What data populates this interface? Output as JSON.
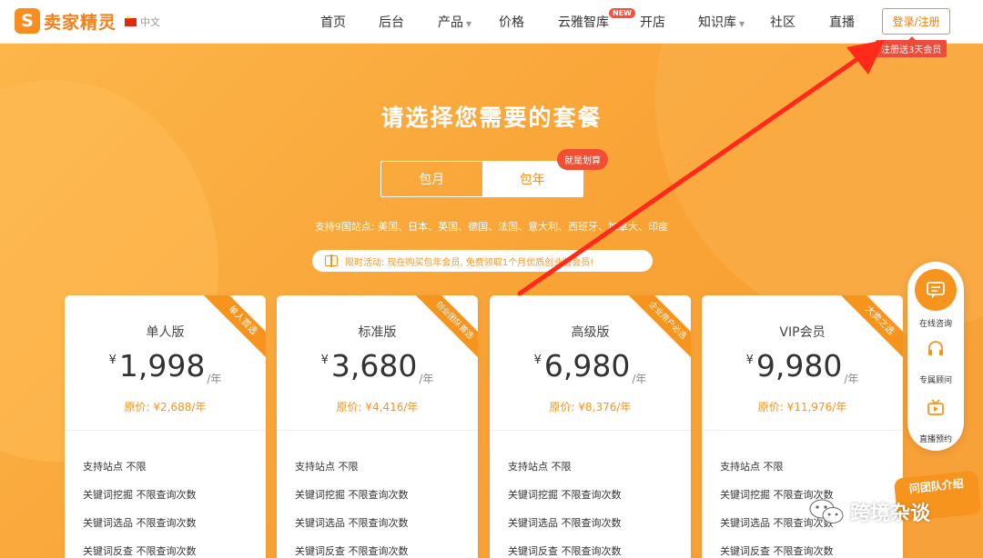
{
  "header": {
    "logo_mark": "S",
    "logo_text": "卖家精灵",
    "language": "中文",
    "nav": [
      {
        "label": "首页"
      },
      {
        "label": "后台"
      },
      {
        "label": "产品"
      },
      {
        "label": "价格"
      },
      {
        "label": "云雅智库"
      },
      {
        "label": "开店"
      },
      {
        "label": "知识库"
      },
      {
        "label": "社区"
      },
      {
        "label": "直播"
      }
    ],
    "new_badge": "NEW",
    "login_label": "登录/注册",
    "register_tip": "注册送3天会员"
  },
  "hero": {
    "title": "请选择您需要的套餐",
    "toggle": {
      "monthly": "包月",
      "yearly": "包年",
      "badge": "就是划算"
    },
    "sites": "支持9国站点: 美国、日本、英国、德国、法国、意大利、西班牙、加拿大、印度",
    "promo": "限时活动: 现在购买包年会员, 免费领取1个月优质创业版会员!"
  },
  "plans": [
    {
      "name": "单人版",
      "ribbon": "单人首选",
      "currency": "¥",
      "price": "1,998",
      "unit": "/年",
      "original": "原价: ¥2,688/年",
      "features": [
        "支持站点 不限",
        "关键词挖掘 不限查询次数",
        "关键词选品 不限查询次数",
        "关键词反查 不限查询次数"
      ]
    },
    {
      "name": "标准版",
      "ribbon": "创业团队首选",
      "currency": "¥",
      "price": "3,680",
      "unit": "/年",
      "original": "原价: ¥4,416/年",
      "features": [
        "支持站点 不限",
        "关键词挖掘 不限查询次数",
        "关键词选品 不限查询次数",
        "关键词反查 不限查询次数"
      ]
    },
    {
      "name": "高级版",
      "ribbon": "企业用户必选",
      "currency": "¥",
      "price": "6,980",
      "unit": "/年",
      "original": "原价: ¥8,376/年",
      "features": [
        "支持站点 不限",
        "关键词挖掘 不限查询次数",
        "关键词选品 不限查询次数",
        "关键词反查 不限查询次数"
      ]
    },
    {
      "name": "VIP会员",
      "ribbon": "大卖之选",
      "currency": "¥",
      "price": "9,980",
      "unit": "/年",
      "original": "原价: ¥11,976/年",
      "features": [
        "支持站点 不限",
        "关键词挖掘 不限查询次数",
        "关键词选品 不限查询次数",
        "关键词反查 不限查询次数"
      ]
    }
  ],
  "side_panel": {
    "consult": "在线咨询",
    "advisor": "专属顾问",
    "live": "直播预约"
  },
  "team_badge": "问团队介绍",
  "watermark": "跨境杂谈",
  "colors": {
    "brand": "#f7941d",
    "accent_red": "#f24f32",
    "annotation_arrow": "#ff2a1a"
  }
}
